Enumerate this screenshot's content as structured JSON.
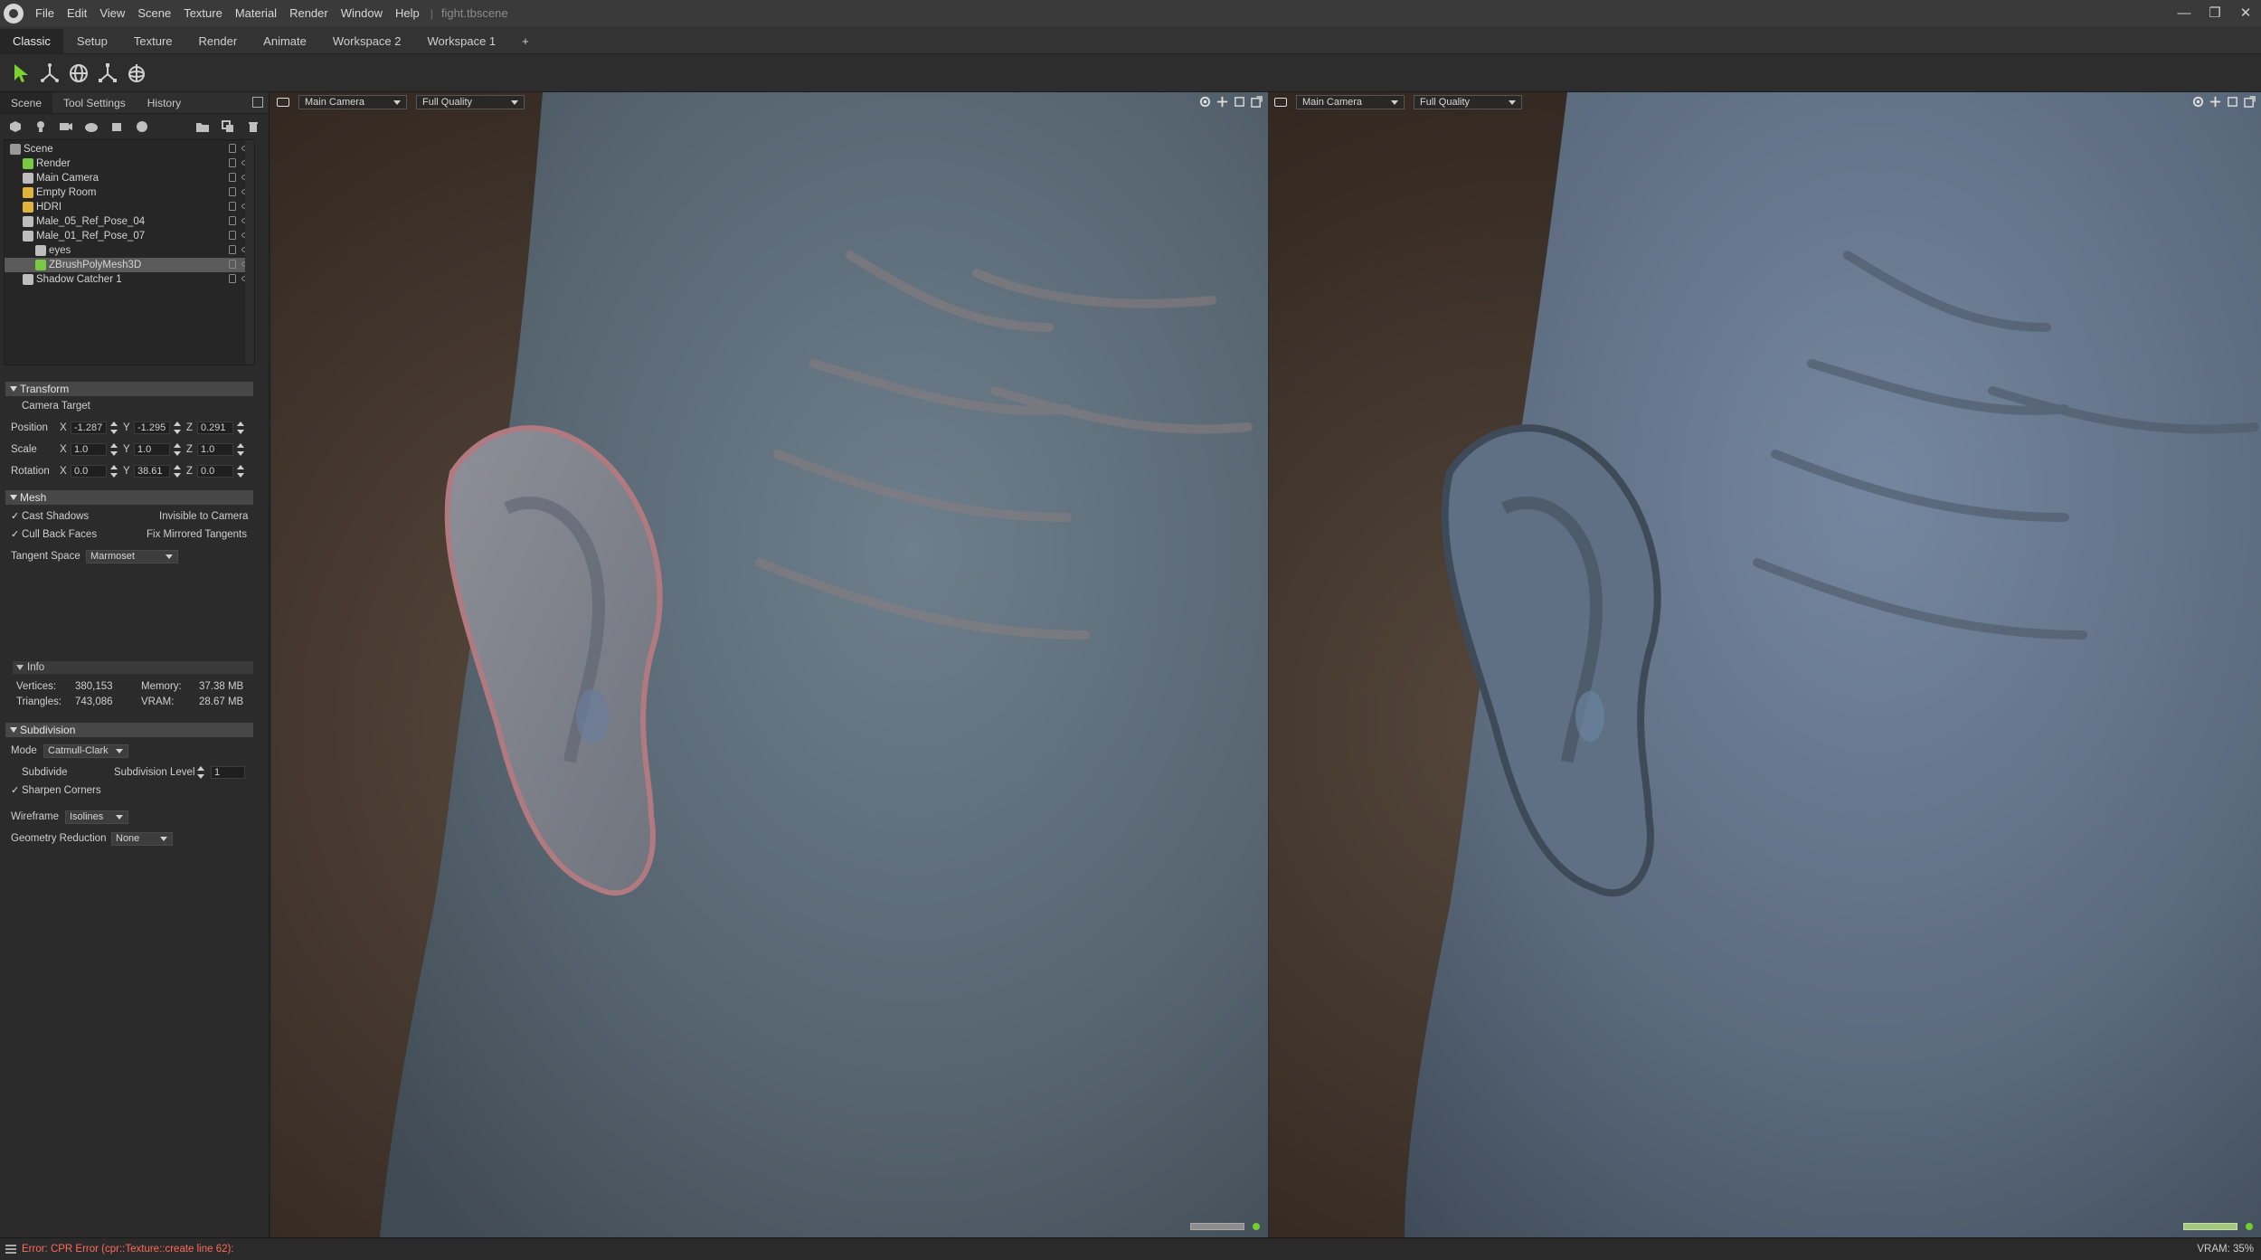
{
  "menubar": {
    "items": [
      "File",
      "Edit",
      "View",
      "Scene",
      "Texture",
      "Material",
      "Render",
      "Window",
      "Help"
    ],
    "file_title": "fight.tbscene",
    "controls": [
      "—",
      "❐",
      "✕"
    ]
  },
  "workspace_tabs": [
    "Classic",
    "Setup",
    "Texture",
    "Render",
    "Animate",
    "Workspace 2",
    "Workspace 1",
    "+"
  ],
  "toolbar": {
    "tools": [
      "select-arrow-icon",
      "move-gizmo-icon",
      "rotate-gizmo-icon",
      "scale-gizmo-icon",
      "world-gizmo-icon"
    ],
    "accent": "#7bd32e"
  },
  "left_panel": {
    "tabs": [
      "Scene",
      "Tool Settings",
      "History"
    ],
    "tree": [
      {
        "label": "Scene",
        "indent": 0,
        "icon_color": "#9a9a9a"
      },
      {
        "label": "Render",
        "indent": 1,
        "icon_color": "#7ac943"
      },
      {
        "label": "Main Camera",
        "indent": 1,
        "icon_color": "#bdbdbd"
      },
      {
        "label": "Empty Room",
        "indent": 1,
        "icon_color": "#e0b33a"
      },
      {
        "label": "HDRI",
        "indent": 1,
        "icon_color": "#e0b33a"
      },
      {
        "label": "Male_05_Ref_Pose_04",
        "indent": 1,
        "icon_color": "#bdbdbd"
      },
      {
        "label": "Male_01_Ref_Pose_07",
        "indent": 1,
        "icon_color": "#bdbdbd"
      },
      {
        "label": "eyes",
        "indent": 2,
        "icon_color": "#bdbdbd"
      },
      {
        "label": "ZBrushPolyMesh3D",
        "indent": 2,
        "icon_color": "#7ac943",
        "selected": true
      },
      {
        "label": "Shadow Catcher 1",
        "indent": 1,
        "icon_color": "#bdbdbd"
      }
    ],
    "transform": {
      "header": "Transform",
      "camera_target": "Camera Target",
      "rows": [
        {
          "label": "Position",
          "x": "-1.287",
          "y": "-1.295",
          "z": "0.291"
        },
        {
          "label": "Scale",
          "x": "1.0",
          "y": "1.0",
          "z": "1.0"
        },
        {
          "label": "Rotation",
          "x": "0.0",
          "y": "38.61",
          "z": "0.0"
        }
      ],
      "axis_x": "X",
      "axis_y": "Y",
      "axis_z": "Z"
    },
    "mesh": {
      "header": "Mesh",
      "cast_shadows": "Cast Shadows",
      "invisible_to_camera": "Invisible to Camera",
      "cull_back_faces": "Cull Back Faces",
      "fix_mirrored_tangents": "Fix Mirrored Tangents",
      "tangent_space_label": "Tangent Space",
      "tangent_space_value": "Marmoset",
      "check_mark": "✓"
    },
    "info": {
      "header": "Info",
      "vertices_label": "Vertices:",
      "vertices_value": "380,153",
      "triangles_label": "Triangles:",
      "triangles_value": "743,086",
      "memory_label": "Memory:",
      "memory_value": "37.38 MB",
      "vram_label": "VRAM:",
      "vram_value": "28.67 MB"
    },
    "subdivision": {
      "header": "Subdivision",
      "mode_label": "Mode",
      "mode_value": "Catmull-Clark",
      "subdivide": "Subdivide",
      "level_label": "Subdivision Level",
      "level_value": "1",
      "sharpen_corners": "Sharpen Corners",
      "wireframe_label": "Wireframe",
      "wireframe_value": "Isolines",
      "geometry_reduction_label": "Geometry Reduction",
      "geometry_reduction_value": "None"
    }
  },
  "viewports": {
    "left": {
      "camera": "Main Camera",
      "quality": "Full Quality"
    },
    "right": {
      "camera": "Main Camera",
      "quality": "Full Quality"
    }
  },
  "status": {
    "error": "Error: CPR Error (cpr::Texture::create line 62):",
    "vram": "VRAM: 35%"
  }
}
